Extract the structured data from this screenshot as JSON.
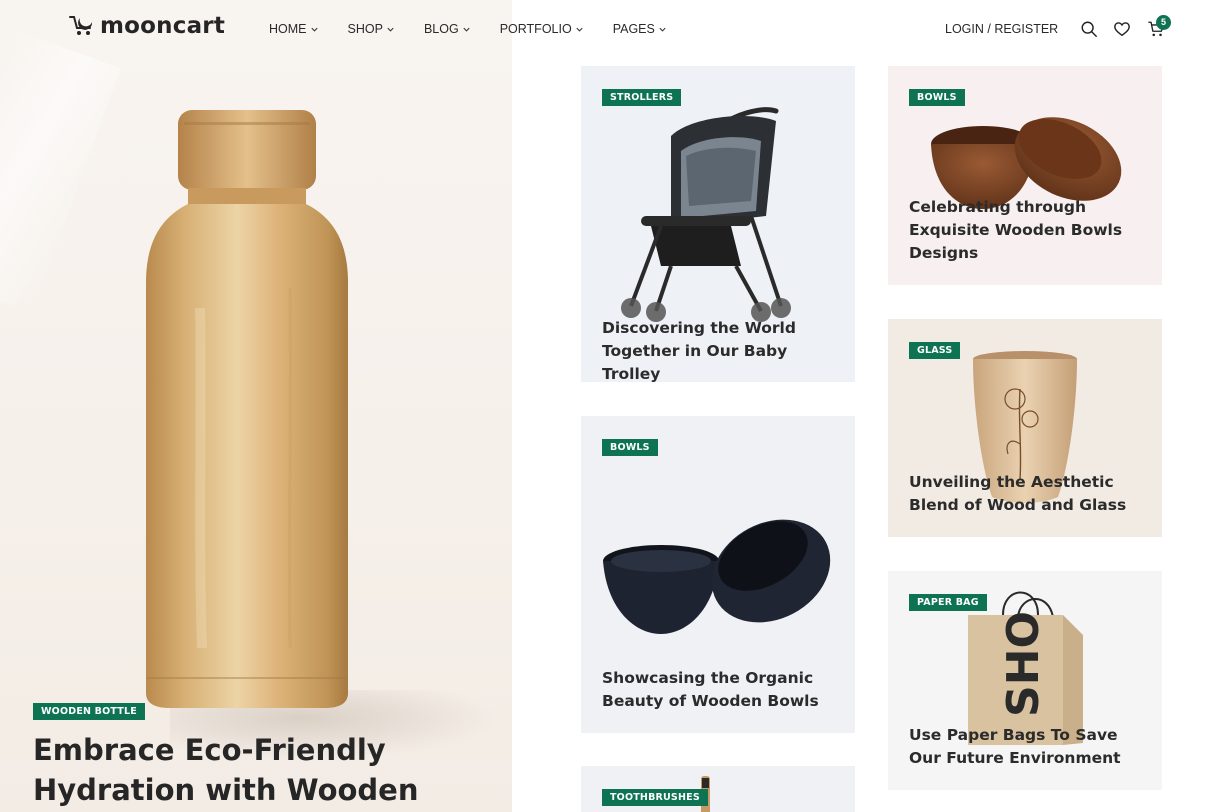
{
  "brand": {
    "name": "mooncart"
  },
  "nav": [
    {
      "label": "HOME"
    },
    {
      "label": "SHOP"
    },
    {
      "label": "BLOG"
    },
    {
      "label": "PORTFOLIO"
    },
    {
      "label": "PAGES"
    }
  ],
  "header": {
    "login_label": "LOGIN / REGISTER",
    "cart_count": "5",
    "icons": [
      "search-icon",
      "heart-icon",
      "cart-icon"
    ]
  },
  "hero": {
    "tag": "WOODEN BOTTLE",
    "title": "Embrace Eco-Friendly Hydration with Wooden"
  },
  "posts": [
    {
      "tag": "STROLLERS",
      "title": "Discovering the World Together in Our Baby Trolley"
    },
    {
      "tag": "BOWLS",
      "title": "Celebrating through Exquisite Wooden Bowls Designs"
    },
    {
      "tag": "GLASS",
      "title": "Unveiling the Aesthetic Blend of Wood and Glass"
    },
    {
      "tag": "BOWLS",
      "title": "Showcasing the Organic Beauty of Wooden Bowls"
    },
    {
      "tag": "PAPER BAG",
      "title": "Use Paper Bags To Save Our Future Environment"
    },
    {
      "tag": "TOOTHBRUSHES",
      "title": ""
    }
  ],
  "colors": {
    "accent": "#0d7353",
    "text": "#262626",
    "card_bg": "#f0f2f5"
  }
}
